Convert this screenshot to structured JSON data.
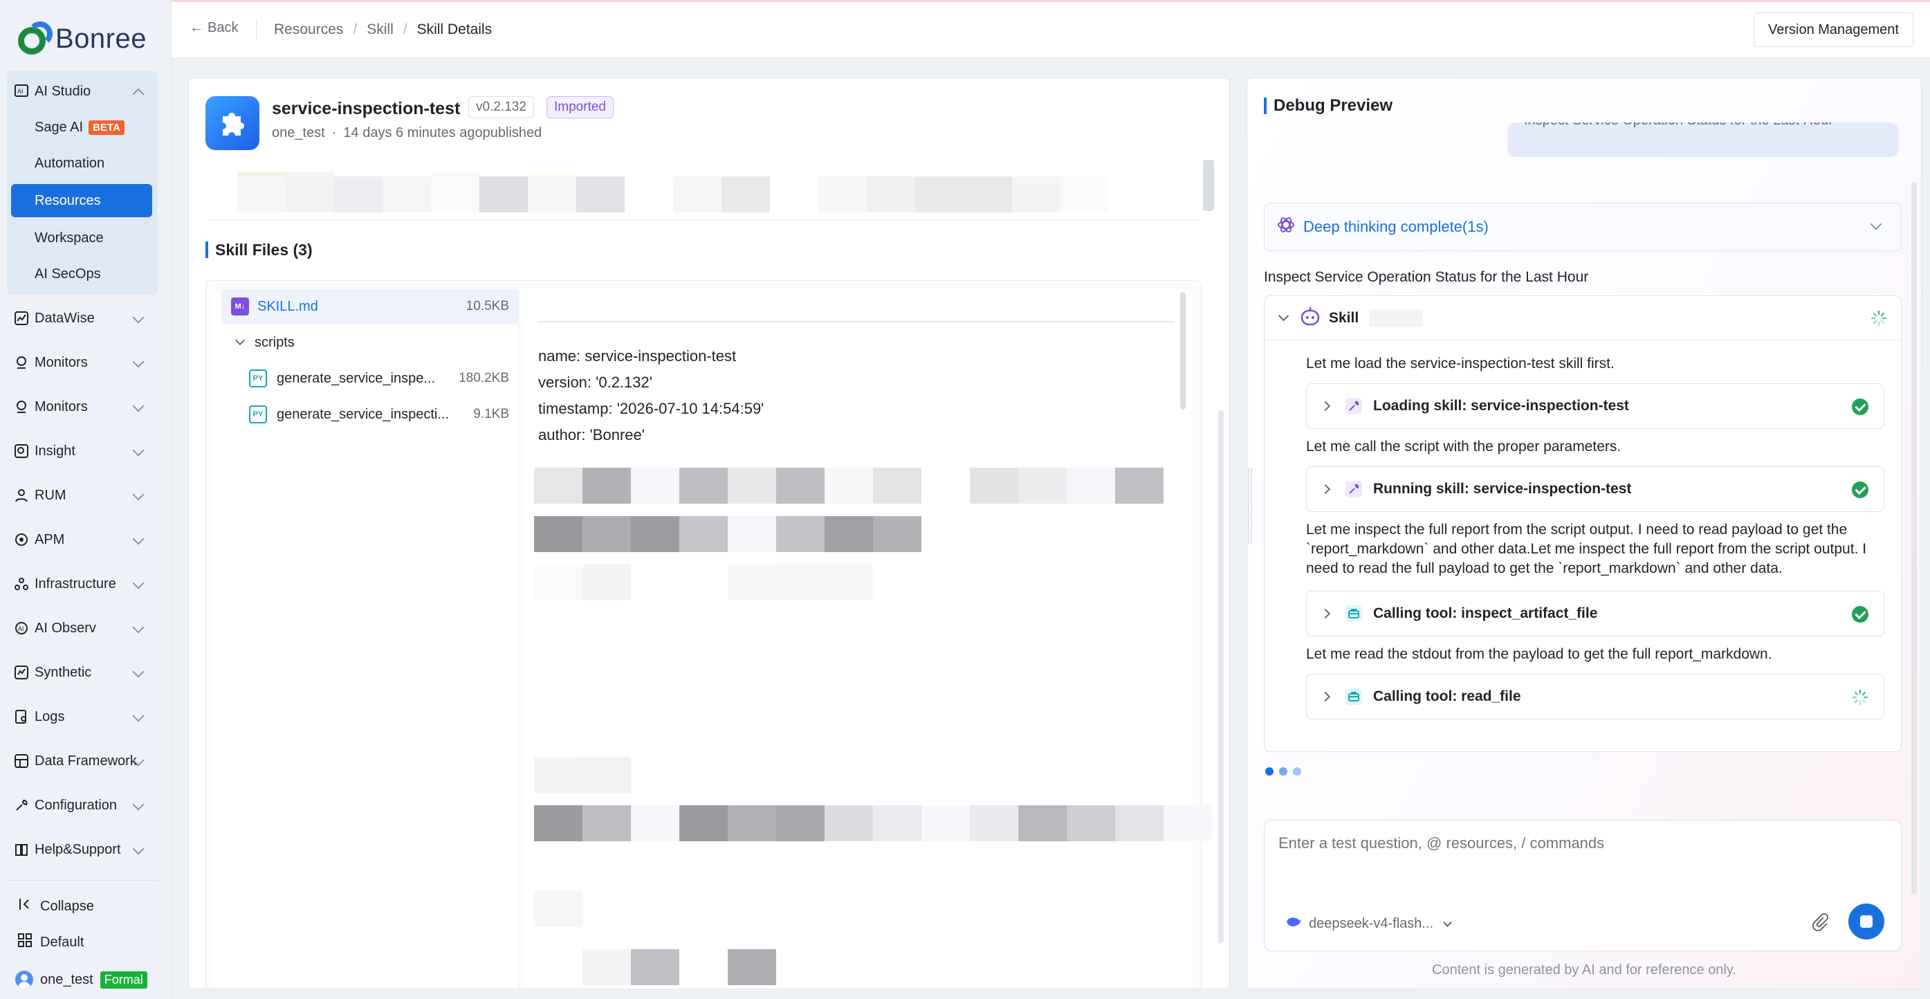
{
  "brand": {
    "name": "Bonree"
  },
  "sidebar": {
    "ai_studio": "AI Studio",
    "sub_items": [
      {
        "label": "Sage AI",
        "badge": "BETA"
      },
      {
        "label": "Automation"
      },
      {
        "label": "Resources"
      },
      {
        "label": "Workspace"
      },
      {
        "label": "AI SecOps"
      }
    ],
    "items": [
      {
        "label": "DataWise"
      },
      {
        "label": "Monitors"
      },
      {
        "label": "Monitors"
      },
      {
        "label": "Insight"
      },
      {
        "label": "RUM"
      },
      {
        "label": "APM"
      },
      {
        "label": "Infrastructure"
      },
      {
        "label": "AI Observ"
      },
      {
        "label": "Synthetic"
      },
      {
        "label": "Logs"
      },
      {
        "label": "Data Framework"
      },
      {
        "label": "Configuration"
      },
      {
        "label": "Help&Support"
      }
    ],
    "collapse": "Collapse",
    "workspace": "Default",
    "user": "one_test",
    "user_badge": "Formal"
  },
  "topbar": {
    "back": "Back",
    "breadcrumb": [
      "Resources",
      "Skill",
      "Skill Details"
    ],
    "version_button": "Version Management"
  },
  "skill": {
    "name": "service-inspection-test",
    "version": "v0.2.132",
    "status": "Imported",
    "owner": "one_test",
    "published": "14 days 6 minutes agopublished"
  },
  "files": {
    "title": "Skill Files (3)",
    "skill_md": {
      "name": "SKILL.md",
      "size": "10.5KB",
      "icon": "M↓"
    },
    "folder": "scripts",
    "scripts": [
      {
        "name": "generate_service_inspe...",
        "size": "180.2KB",
        "icon": "PY"
      },
      {
        "name": "generate_service_inspecti...",
        "size": "9.1KB",
        "icon": "PY"
      }
    ],
    "yaml": [
      "name: service-inspection-test",
      "version: '0.2.132'",
      "timestamp: '2026-07-10 14:54:59'",
      "author: 'Bonree'"
    ]
  },
  "debug": {
    "title": "Debug Preview",
    "user_message": "Inspect Service Operation Status for the Last Hour",
    "thinking": "Deep thinking complete(1s)",
    "task_title": "Inspect Service Operation Status for the Last Hour",
    "skill_label": "Skill",
    "steps": [
      "Let me load the service-inspection-test skill first.",
      "Let me call the script with the proper parameters.",
      "Let me inspect the full report from the script output. I need to read payload to get the `report_markdown` and other data.Let me inspect the full report from the script output. I need to read the full payload to get the `report_markdown` and other data.",
      "Let me read the stdout from the payload to get the full report_markdown."
    ],
    "tools": [
      {
        "label": "Loading skill: service-inspection-test",
        "status": "done"
      },
      {
        "label": "Running skill: service-inspection-test",
        "status": "done"
      },
      {
        "label": "Calling tool: inspect_artifact_file",
        "status": "done"
      },
      {
        "label": "Calling tool: read_file",
        "status": "loading"
      }
    ],
    "input_placeholder": "Enter a test question, @ resources, / commands",
    "model": "deepseek-v4-flash...",
    "footer": "Content is generated by AI and for reference only."
  },
  "colors": {
    "accent": "#1a6fdf",
    "success": "#21a05a",
    "beta": "#f0642d",
    "formal": "#19b13b"
  }
}
